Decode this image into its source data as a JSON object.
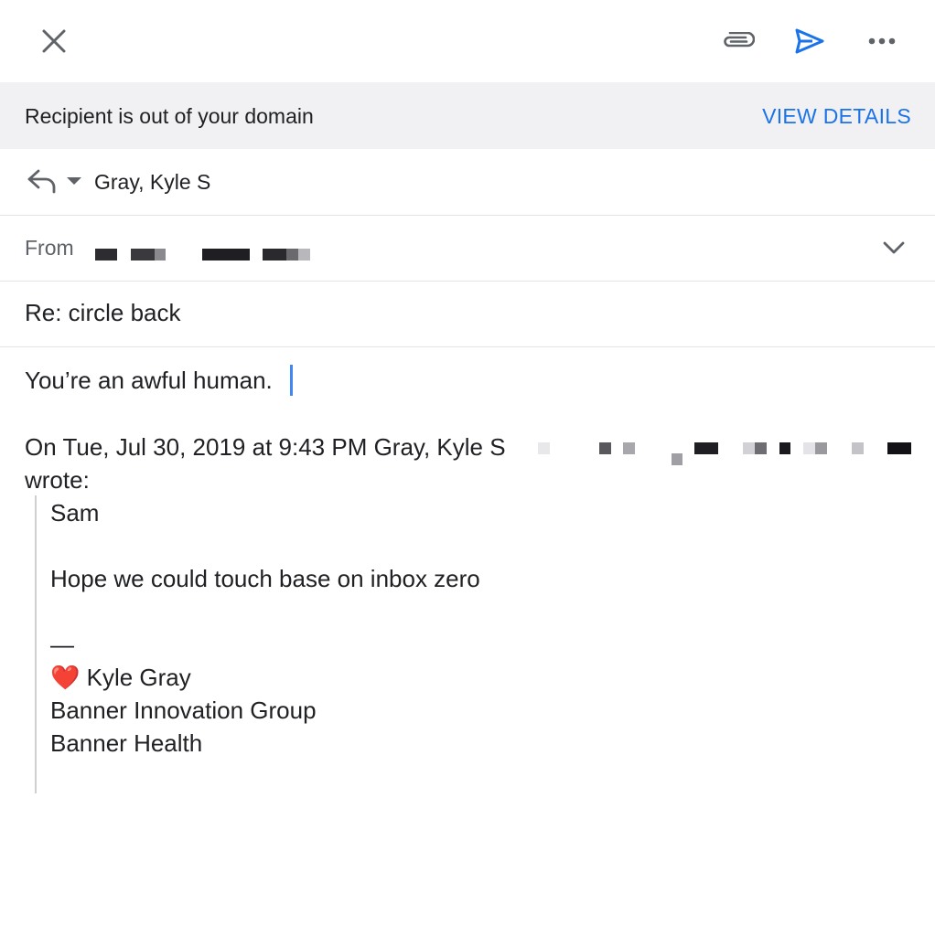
{
  "toolbar": {
    "close_icon": "close-icon",
    "attach_icon": "paperclip-icon",
    "send_icon": "send-icon",
    "more_icon": "more-horizontal-icon"
  },
  "banner": {
    "message": "Recipient is out of your domain",
    "action": "VIEW DETAILS"
  },
  "to": {
    "name": "Gray, Kyle S"
  },
  "from": {
    "label": "From"
  },
  "subject": "Re: circle back",
  "body": {
    "text": "You’re an awful human.",
    "quote_header": "On Tue, Jul 30, 2019 at 9:43 PM Gray, Kyle S",
    "wrote": "wrote:",
    "quoted_lines": {
      "greeting": "Sam",
      "message": "Hope we could touch base on inbox zero",
      "dash": "—",
      "sig_heart": "❤️",
      "sig_name": "Kyle Gray",
      "sig_org": "Banner Innovation Group",
      "sig_company": "Banner Health"
    }
  },
  "colors": {
    "accent": "#1a73e8",
    "banner_bg": "#f1f1f3",
    "cursor": "#4285f4"
  }
}
